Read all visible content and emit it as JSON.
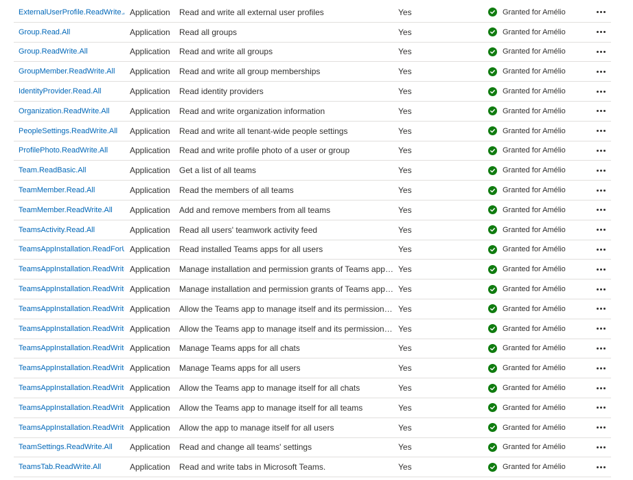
{
  "permissions": [
    {
      "name": "ExternalUserProfile.ReadWrite.All",
      "type": "Application",
      "description": "Read and write all external user profiles",
      "admin_consent": "Yes",
      "status": "Granted for Amélio"
    },
    {
      "name": "Group.Read.All",
      "type": "Application",
      "description": "Read all groups",
      "admin_consent": "Yes",
      "status": "Granted for Amélio"
    },
    {
      "name": "Group.ReadWrite.All",
      "type": "Application",
      "description": "Read and write all groups",
      "admin_consent": "Yes",
      "status": "Granted for Amélio"
    },
    {
      "name": "GroupMember.ReadWrite.All",
      "type": "Application",
      "description": "Read and write all group memberships",
      "admin_consent": "Yes",
      "status": "Granted for Amélio"
    },
    {
      "name": "IdentityProvider.Read.All",
      "type": "Application",
      "description": "Read identity providers",
      "admin_consent": "Yes",
      "status": "Granted for Amélio"
    },
    {
      "name": "Organization.ReadWrite.All",
      "type": "Application",
      "description": "Read and write organization information",
      "admin_consent": "Yes",
      "status": "Granted for Amélio"
    },
    {
      "name": "PeopleSettings.ReadWrite.All",
      "type": "Application",
      "description": "Read and write all tenant-wide people settings",
      "admin_consent": "Yes",
      "status": "Granted for Amélio"
    },
    {
      "name": "ProfilePhoto.ReadWrite.All",
      "type": "Application",
      "description": "Read and write profile photo of a user or group",
      "admin_consent": "Yes",
      "status": "Granted for Amélio"
    },
    {
      "name": "Team.ReadBasic.All",
      "type": "Application",
      "description": "Get a list of all teams",
      "admin_consent": "Yes",
      "status": "Granted for Amélio"
    },
    {
      "name": "TeamMember.Read.All",
      "type": "Application",
      "description": "Read the members of all teams",
      "admin_consent": "Yes",
      "status": "Granted for Amélio"
    },
    {
      "name": "TeamMember.ReadWrite.All",
      "type": "Application",
      "description": "Add and remove members from all teams",
      "admin_consent": "Yes",
      "status": "Granted for Amélio"
    },
    {
      "name": "TeamsActivity.Read.All",
      "type": "Application",
      "description": "Read all users' teamwork activity feed",
      "admin_consent": "Yes",
      "status": "Granted for Amélio"
    },
    {
      "name": "TeamsAppInstallation.ReadForUs",
      "type": "Application",
      "description": "Read installed Teams apps for all users",
      "admin_consent": "Yes",
      "status": "Granted for Amélio"
    },
    {
      "name": "TeamsAppInstallation.ReadWrite",
      "type": "Application",
      "description": "Manage installation and permission grants of Teams apps ...",
      "admin_consent": "Yes",
      "status": "Granted for Amélio"
    },
    {
      "name": "TeamsAppInstallation.ReadWrite",
      "type": "Application",
      "description": "Manage installation and permission grants of Teams apps ...",
      "admin_consent": "Yes",
      "status": "Granted for Amélio"
    },
    {
      "name": "TeamsAppInstallation.ReadWrite",
      "type": "Application",
      "description": "Allow the Teams app to manage itself and its permission g...",
      "admin_consent": "Yes",
      "status": "Granted for Amélio"
    },
    {
      "name": "TeamsAppInstallation.ReadWrite",
      "type": "Application",
      "description": "Allow the Teams app to manage itself and its permission g...",
      "admin_consent": "Yes",
      "status": "Granted for Amélio"
    },
    {
      "name": "TeamsAppInstallation.ReadWrite",
      "type": "Application",
      "description": "Manage Teams apps for all chats",
      "admin_consent": "Yes",
      "status": "Granted for Amélio"
    },
    {
      "name": "TeamsAppInstallation.ReadWrite",
      "type": "Application",
      "description": "Manage Teams apps for all users",
      "admin_consent": "Yes",
      "status": "Granted for Amélio"
    },
    {
      "name": "TeamsAppInstallation.ReadWrite",
      "type": "Application",
      "description": "Allow the Teams app to manage itself for all chats",
      "admin_consent": "Yes",
      "status": "Granted for Amélio"
    },
    {
      "name": "TeamsAppInstallation.ReadWrite",
      "type": "Application",
      "description": "Allow the Teams app to manage itself for all teams",
      "admin_consent": "Yes",
      "status": "Granted for Amélio"
    },
    {
      "name": "TeamsAppInstallation.ReadWrite",
      "type": "Application",
      "description": "Allow the app to manage itself for all users",
      "admin_consent": "Yes",
      "status": "Granted for Amélio"
    },
    {
      "name": "TeamSettings.ReadWrite.All",
      "type": "Application",
      "description": "Read and change all teams' settings",
      "admin_consent": "Yes",
      "status": "Granted for Amélio"
    },
    {
      "name": "TeamsTab.ReadWrite.All",
      "type": "Application",
      "description": "Read and write tabs in Microsoft Teams.",
      "admin_consent": "Yes",
      "status": "Granted for Amélio"
    }
  ],
  "icons": {
    "status": "check-circle-icon",
    "more": "more-horizontal-icon"
  },
  "colors": {
    "link": "#0067b8",
    "success": "#107c10",
    "text": "#323130",
    "divider": "#e1dfdd"
  }
}
